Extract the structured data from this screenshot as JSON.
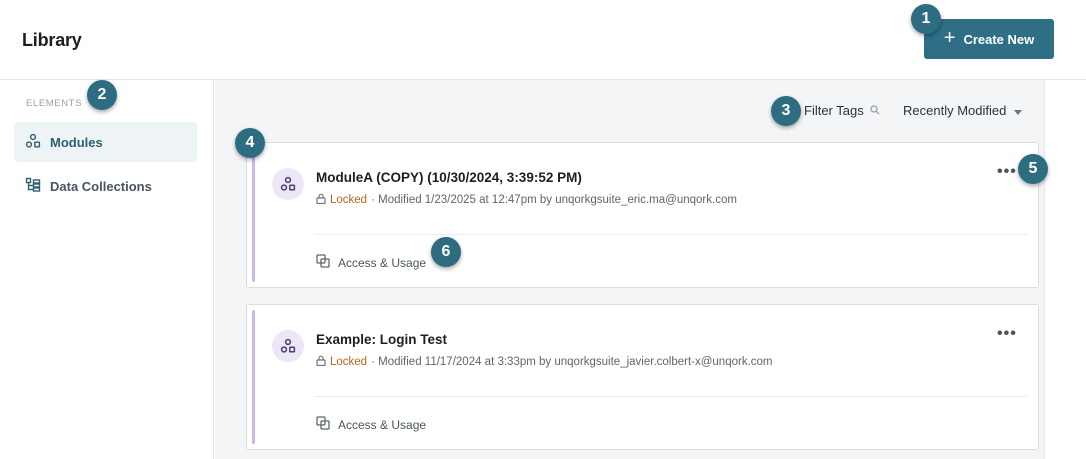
{
  "header": {
    "title": "Library",
    "create_button": "Create New",
    "accent_color": "#2f6f86"
  },
  "sidebar": {
    "section_label": "ELEMENTS",
    "items": [
      {
        "label": "Modules",
        "icon": "modules-icon",
        "active": true
      },
      {
        "label": "Data Collections",
        "icon": "data-collections-icon",
        "active": false
      }
    ]
  },
  "toolbar": {
    "filter_tags": "Filter Tags",
    "sort_selected": "Recently Modified"
  },
  "cards": [
    {
      "title": "ModuleA (COPY) (10/30/2024, 3:39:52 PM)",
      "status": "Locked",
      "meta": "· Modified 1/23/2025 at 12:47pm by unqorkgsuite_eric.ma@unqork.com",
      "access_label": "Access & Usage"
    },
    {
      "title": "Example: Login Test",
      "status": "Locked",
      "meta": "· Modified 11/17/2024 at 3:33pm by unqorkgsuite_javier.colbert-x@unqork.com",
      "access_label": "Access & Usage"
    }
  ],
  "callouts": [
    "1",
    "2",
    "3",
    "4",
    "5",
    "6"
  ]
}
